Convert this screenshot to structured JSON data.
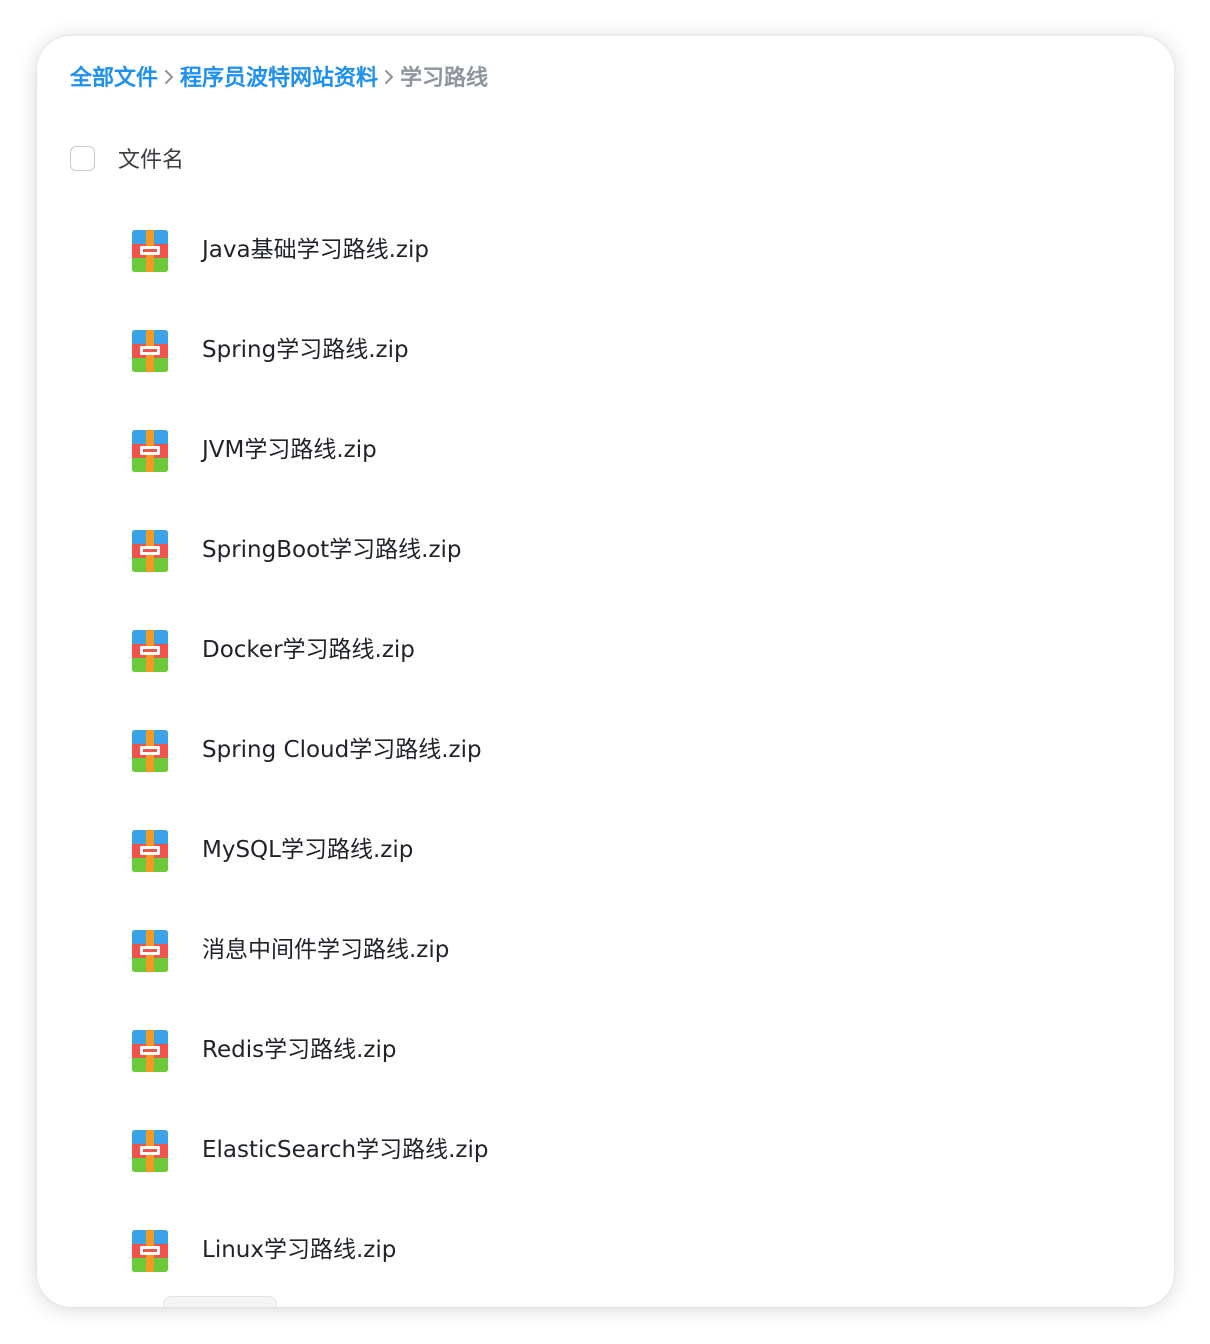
{
  "breadcrumb": {
    "items": [
      {
        "label": "全部文件"
      },
      {
        "label": "程序员波特网站资料"
      }
    ],
    "current": "学习路线"
  },
  "list_header": {
    "name_label": "文件名"
  },
  "files": [
    {
      "name": "Java基础学习路线.zip",
      "icon": "zip-archive-icon"
    },
    {
      "name": "Spring学习路线.zip",
      "icon": "zip-archive-icon"
    },
    {
      "name": "JVM学习路线.zip",
      "icon": "zip-archive-icon"
    },
    {
      "name": "SpringBoot学习路线.zip",
      "icon": "zip-archive-icon"
    },
    {
      "name": "Docker学习路线.zip",
      "icon": "zip-archive-icon"
    },
    {
      "name": "Spring Cloud学习路线.zip",
      "icon": "zip-archive-icon"
    },
    {
      "name": "MySQL学习路线.zip",
      "icon": "zip-archive-icon"
    },
    {
      "name": "消息中间件学习路线.zip",
      "icon": "zip-archive-icon"
    },
    {
      "name": "Redis学习路线.zip",
      "icon": "zip-archive-icon"
    },
    {
      "name": "ElasticSearch学习路线.zip",
      "icon": "zip-archive-icon"
    },
    {
      "name": "Linux学习路线.zip",
      "icon": "zip-archive-icon"
    }
  ],
  "colors": {
    "link": "#1e90f0",
    "current_crumb": "#8f959e",
    "file_text": "#1f2329",
    "zip_blue": "#3aa3e8",
    "zip_red": "#f0534a",
    "zip_orange": "#f59a23",
    "zip_green": "#6cc93a"
  }
}
